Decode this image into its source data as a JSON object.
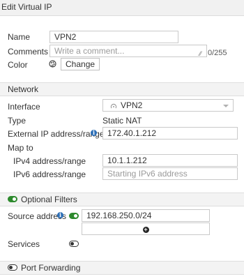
{
  "window": {
    "title": "Edit Virtual IP"
  },
  "general": {
    "name_label": "Name",
    "name_value": "VPN2",
    "comments_label": "Comments",
    "comments_placeholder": "Write a comment...",
    "comments_counter": "0/255",
    "color_label": "Color",
    "color_button": "Change"
  },
  "network": {
    "section_title": "Network",
    "interface_label": "Interface",
    "interface_value": "VPN2",
    "type_label": "Type",
    "type_value": "Static NAT",
    "external_ip_label": "External IP address/range",
    "external_ip_value": "172.40.1.212",
    "map_to_label": "Map to",
    "ipv4_label": "IPv4 address/range",
    "ipv4_value": "10.1.1.212",
    "ipv6_label": "IPv6 address/range",
    "ipv6_placeholder": "Starting IPv6 address"
  },
  "optional_filters": {
    "section_title": "Optional Filters",
    "enabled": true,
    "source_address_label": "Source address",
    "source_address_enabled": true,
    "source_address_value": "192.168.250.0/24",
    "add_button": "+",
    "services_label": "Services",
    "services_enabled": false
  },
  "port_forwarding": {
    "section_title": "Port Forwarding",
    "enabled": false
  },
  "colors": {
    "toggle_on": "#2d8a2d",
    "info_icon": "#2d6fb7",
    "section_bg": "#f3f3f3"
  }
}
